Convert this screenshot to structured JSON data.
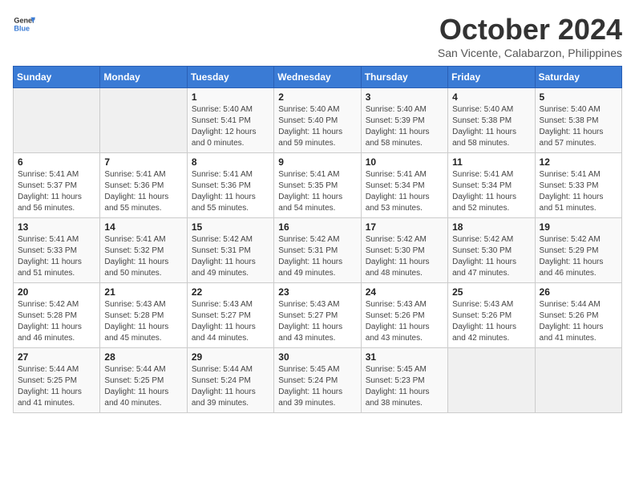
{
  "header": {
    "logo_general": "General",
    "logo_blue": "Blue",
    "title": "October 2024",
    "subtitle": "San Vicente, Calabarzon, Philippines"
  },
  "weekdays": [
    "Sunday",
    "Monday",
    "Tuesday",
    "Wednesday",
    "Thursday",
    "Friday",
    "Saturday"
  ],
  "weeks": [
    [
      {
        "day": "",
        "detail": ""
      },
      {
        "day": "",
        "detail": ""
      },
      {
        "day": "1",
        "detail": "Sunrise: 5:40 AM\nSunset: 5:41 PM\nDaylight: 12 hours\nand 0 minutes."
      },
      {
        "day": "2",
        "detail": "Sunrise: 5:40 AM\nSunset: 5:40 PM\nDaylight: 11 hours\nand 59 minutes."
      },
      {
        "day": "3",
        "detail": "Sunrise: 5:40 AM\nSunset: 5:39 PM\nDaylight: 11 hours\nand 58 minutes."
      },
      {
        "day": "4",
        "detail": "Sunrise: 5:40 AM\nSunset: 5:38 PM\nDaylight: 11 hours\nand 58 minutes."
      },
      {
        "day": "5",
        "detail": "Sunrise: 5:40 AM\nSunset: 5:38 PM\nDaylight: 11 hours\nand 57 minutes."
      }
    ],
    [
      {
        "day": "6",
        "detail": "Sunrise: 5:41 AM\nSunset: 5:37 PM\nDaylight: 11 hours\nand 56 minutes."
      },
      {
        "day": "7",
        "detail": "Sunrise: 5:41 AM\nSunset: 5:36 PM\nDaylight: 11 hours\nand 55 minutes."
      },
      {
        "day": "8",
        "detail": "Sunrise: 5:41 AM\nSunset: 5:36 PM\nDaylight: 11 hours\nand 55 minutes."
      },
      {
        "day": "9",
        "detail": "Sunrise: 5:41 AM\nSunset: 5:35 PM\nDaylight: 11 hours\nand 54 minutes."
      },
      {
        "day": "10",
        "detail": "Sunrise: 5:41 AM\nSunset: 5:34 PM\nDaylight: 11 hours\nand 53 minutes."
      },
      {
        "day": "11",
        "detail": "Sunrise: 5:41 AM\nSunset: 5:34 PM\nDaylight: 11 hours\nand 52 minutes."
      },
      {
        "day": "12",
        "detail": "Sunrise: 5:41 AM\nSunset: 5:33 PM\nDaylight: 11 hours\nand 51 minutes."
      }
    ],
    [
      {
        "day": "13",
        "detail": "Sunrise: 5:41 AM\nSunset: 5:33 PM\nDaylight: 11 hours\nand 51 minutes."
      },
      {
        "day": "14",
        "detail": "Sunrise: 5:41 AM\nSunset: 5:32 PM\nDaylight: 11 hours\nand 50 minutes."
      },
      {
        "day": "15",
        "detail": "Sunrise: 5:42 AM\nSunset: 5:31 PM\nDaylight: 11 hours\nand 49 minutes."
      },
      {
        "day": "16",
        "detail": "Sunrise: 5:42 AM\nSunset: 5:31 PM\nDaylight: 11 hours\nand 49 minutes."
      },
      {
        "day": "17",
        "detail": "Sunrise: 5:42 AM\nSunset: 5:30 PM\nDaylight: 11 hours\nand 48 minutes."
      },
      {
        "day": "18",
        "detail": "Sunrise: 5:42 AM\nSunset: 5:30 PM\nDaylight: 11 hours\nand 47 minutes."
      },
      {
        "day": "19",
        "detail": "Sunrise: 5:42 AM\nSunset: 5:29 PM\nDaylight: 11 hours\nand 46 minutes."
      }
    ],
    [
      {
        "day": "20",
        "detail": "Sunrise: 5:42 AM\nSunset: 5:28 PM\nDaylight: 11 hours\nand 46 minutes."
      },
      {
        "day": "21",
        "detail": "Sunrise: 5:43 AM\nSunset: 5:28 PM\nDaylight: 11 hours\nand 45 minutes."
      },
      {
        "day": "22",
        "detail": "Sunrise: 5:43 AM\nSunset: 5:27 PM\nDaylight: 11 hours\nand 44 minutes."
      },
      {
        "day": "23",
        "detail": "Sunrise: 5:43 AM\nSunset: 5:27 PM\nDaylight: 11 hours\nand 43 minutes."
      },
      {
        "day": "24",
        "detail": "Sunrise: 5:43 AM\nSunset: 5:26 PM\nDaylight: 11 hours\nand 43 minutes."
      },
      {
        "day": "25",
        "detail": "Sunrise: 5:43 AM\nSunset: 5:26 PM\nDaylight: 11 hours\nand 42 minutes."
      },
      {
        "day": "26",
        "detail": "Sunrise: 5:44 AM\nSunset: 5:26 PM\nDaylight: 11 hours\nand 41 minutes."
      }
    ],
    [
      {
        "day": "27",
        "detail": "Sunrise: 5:44 AM\nSunset: 5:25 PM\nDaylight: 11 hours\nand 41 minutes."
      },
      {
        "day": "28",
        "detail": "Sunrise: 5:44 AM\nSunset: 5:25 PM\nDaylight: 11 hours\nand 40 minutes."
      },
      {
        "day": "29",
        "detail": "Sunrise: 5:44 AM\nSunset: 5:24 PM\nDaylight: 11 hours\nand 39 minutes."
      },
      {
        "day": "30",
        "detail": "Sunrise: 5:45 AM\nSunset: 5:24 PM\nDaylight: 11 hours\nand 39 minutes."
      },
      {
        "day": "31",
        "detail": "Sunrise: 5:45 AM\nSunset: 5:23 PM\nDaylight: 11 hours\nand 38 minutes."
      },
      {
        "day": "",
        "detail": ""
      },
      {
        "day": "",
        "detail": ""
      }
    ]
  ]
}
